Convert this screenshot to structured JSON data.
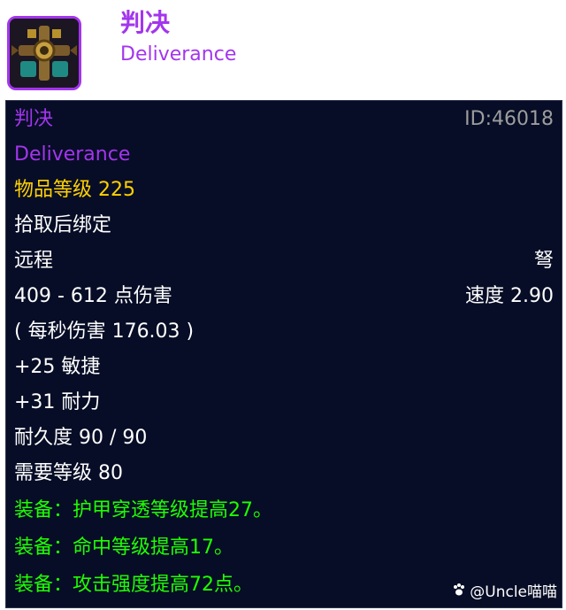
{
  "header": {
    "title": "判决",
    "subtitle": "Deliverance",
    "icon": "crossbow-item-icon"
  },
  "tooltip": {
    "name": "判决",
    "item_id": "ID:46018",
    "name_en": "Deliverance",
    "item_level": "物品等级 225",
    "bind": "拾取后绑定",
    "slot": "远程",
    "weapon_type": "弩",
    "damage": "409 - 612 点伤害",
    "speed": "速度 2.90",
    "dps": "( 每秒伤害 176.03 )",
    "stat_agility": "+25 敏捷",
    "stat_stamina": "+31 耐力",
    "durability": "耐久度 90 / 90",
    "required_level": "需要等级 80",
    "equip_1": "装备：护甲穿透等级提高27。",
    "equip_2": "装备：命中等级提高17。",
    "equip_3": "装备：攻击强度提高72点。"
  },
  "watermark": {
    "text": "@Uncle喵喵"
  },
  "colors": {
    "epic": "#a335ee",
    "item_level": "#ffd100",
    "equip": "#1eff00",
    "tooltip_bg": "#070d26"
  }
}
